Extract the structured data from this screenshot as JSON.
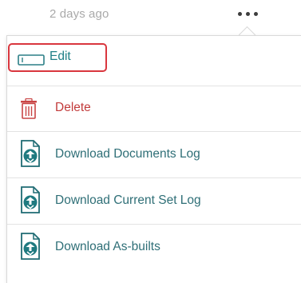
{
  "header": {
    "timestamp": "2 days ago",
    "more_icon": "more-horizontal-icon"
  },
  "menu": {
    "items": [
      {
        "label": "Edit",
        "icon": "edit-bar-icon",
        "color": "#1e7f86",
        "highlighted": true
      },
      {
        "label": "Delete",
        "icon": "trash-icon",
        "color": "#c23b3b"
      },
      {
        "label": "Download Documents Log",
        "icon": "download-file-icon",
        "color": "#2f6f77"
      },
      {
        "label": "Download Current Set Log",
        "icon": "download-file-icon",
        "color": "#2f6f77"
      },
      {
        "label": "Download As-builts",
        "icon": "download-file-icon",
        "color": "#2f6f77"
      }
    ]
  },
  "colors": {
    "accent_teal": "#1e7f86",
    "danger_red": "#c23b3b",
    "highlight_border": "#d9363e",
    "muted_text": "#a9a9a9"
  }
}
